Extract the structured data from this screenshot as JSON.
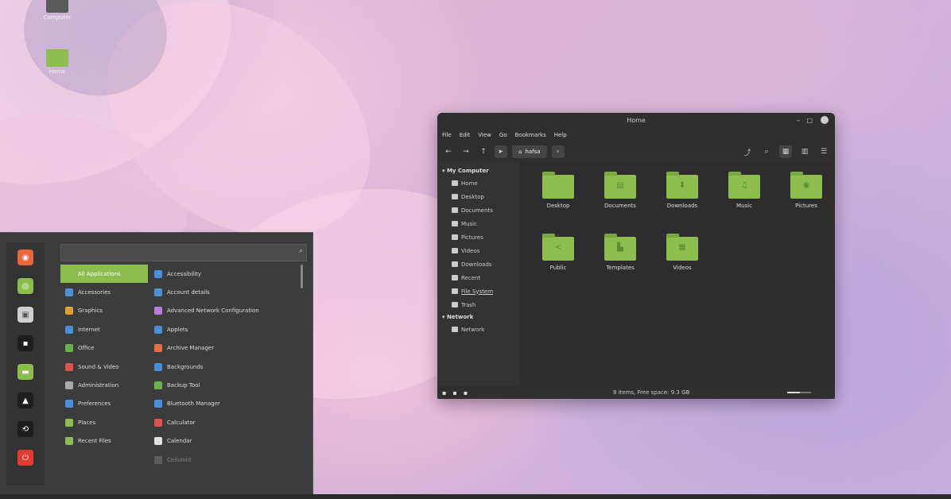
{
  "desktop": {
    "icons": [
      {
        "label": "Computer",
        "color": "#5a5a5a"
      },
      {
        "label": "Home",
        "color": "#8dbc4f"
      }
    ]
  },
  "file_manager": {
    "title": "Home",
    "menu": [
      "File",
      "Edit",
      "View",
      "Go",
      "Bookmarks",
      "Help"
    ],
    "breadcrumb": "hafsa",
    "sidebar": {
      "my_computer": "My Computer",
      "items": [
        "Home",
        "Desktop",
        "Documents",
        "Music",
        "Pictures",
        "Videos",
        "Downloads",
        "Recent",
        "File System",
        "Trash"
      ],
      "network_head": "Network",
      "network_items": [
        "Network"
      ]
    },
    "folders": [
      {
        "name": "Desktop",
        "icon": ""
      },
      {
        "name": "Documents",
        "icon": "▤"
      },
      {
        "name": "Downloads",
        "icon": "⬇"
      },
      {
        "name": "Music",
        "icon": "♫"
      },
      {
        "name": "Pictures",
        "icon": "◉"
      },
      {
        "name": "Public",
        "icon": "<"
      },
      {
        "name": "Templates",
        "icon": "▙"
      },
      {
        "name": "Videos",
        "icon": "▦"
      }
    ],
    "status": "8 items, Free space: 9.3 GB"
  },
  "start_menu": {
    "categories": [
      "All Applications",
      "Accessories",
      "Graphics",
      "Internet",
      "Office",
      "Sound & Video",
      "Administration",
      "Preferences",
      "Places",
      "Recent Files"
    ],
    "apps": [
      "Accessibility",
      "Account details",
      "Advanced Network Configuration",
      "Applets",
      "Archive Manager",
      "Backgrounds",
      "Backup Tool",
      "Bluetooth Manager",
      "Calculator",
      "Calendar",
      "Celluloid"
    ],
    "category_colors": [
      "#8dbc4f",
      "#4a90d9",
      "#e0a030",
      "#4a90d9",
      "#6ab04c",
      "#d9534f",
      "#aaaaaa",
      "#4a90d9",
      "#8dbc4f",
      "#8dbc4f"
    ],
    "app_colors": [
      "#4a90d9",
      "#4a90d9",
      "#b47fd6",
      "#4a90d9",
      "#e07040",
      "#4a90d9",
      "#6ab04c",
      "#4a90d9",
      "#d9534f",
      "#e0e0e0",
      "#888888"
    ],
    "favorites": [
      {
        "icon": "firefox-icon",
        "color": "#e8673c",
        "glyph": "◉"
      },
      {
        "icon": "software-manager-icon",
        "color": "#8dbc4f",
        "glyph": "◎"
      },
      {
        "icon": "settings-icon",
        "color": "#cfcfcf",
        "glyph": "▣"
      },
      {
        "icon": "terminal-icon",
        "color": "#1e1e1e",
        "glyph": "▪"
      },
      {
        "icon": "files-icon",
        "color": "#8dbc4f",
        "glyph": "▬"
      },
      {
        "icon": "lock-icon",
        "color": "#1e1e1e",
        "glyph": "🔒"
      },
      {
        "icon": "logout-icon",
        "color": "#1e1e1e",
        "glyph": "⟲"
      },
      {
        "icon": "power-icon",
        "color": "#e53935",
        "glyph": "⏻"
      }
    ]
  }
}
